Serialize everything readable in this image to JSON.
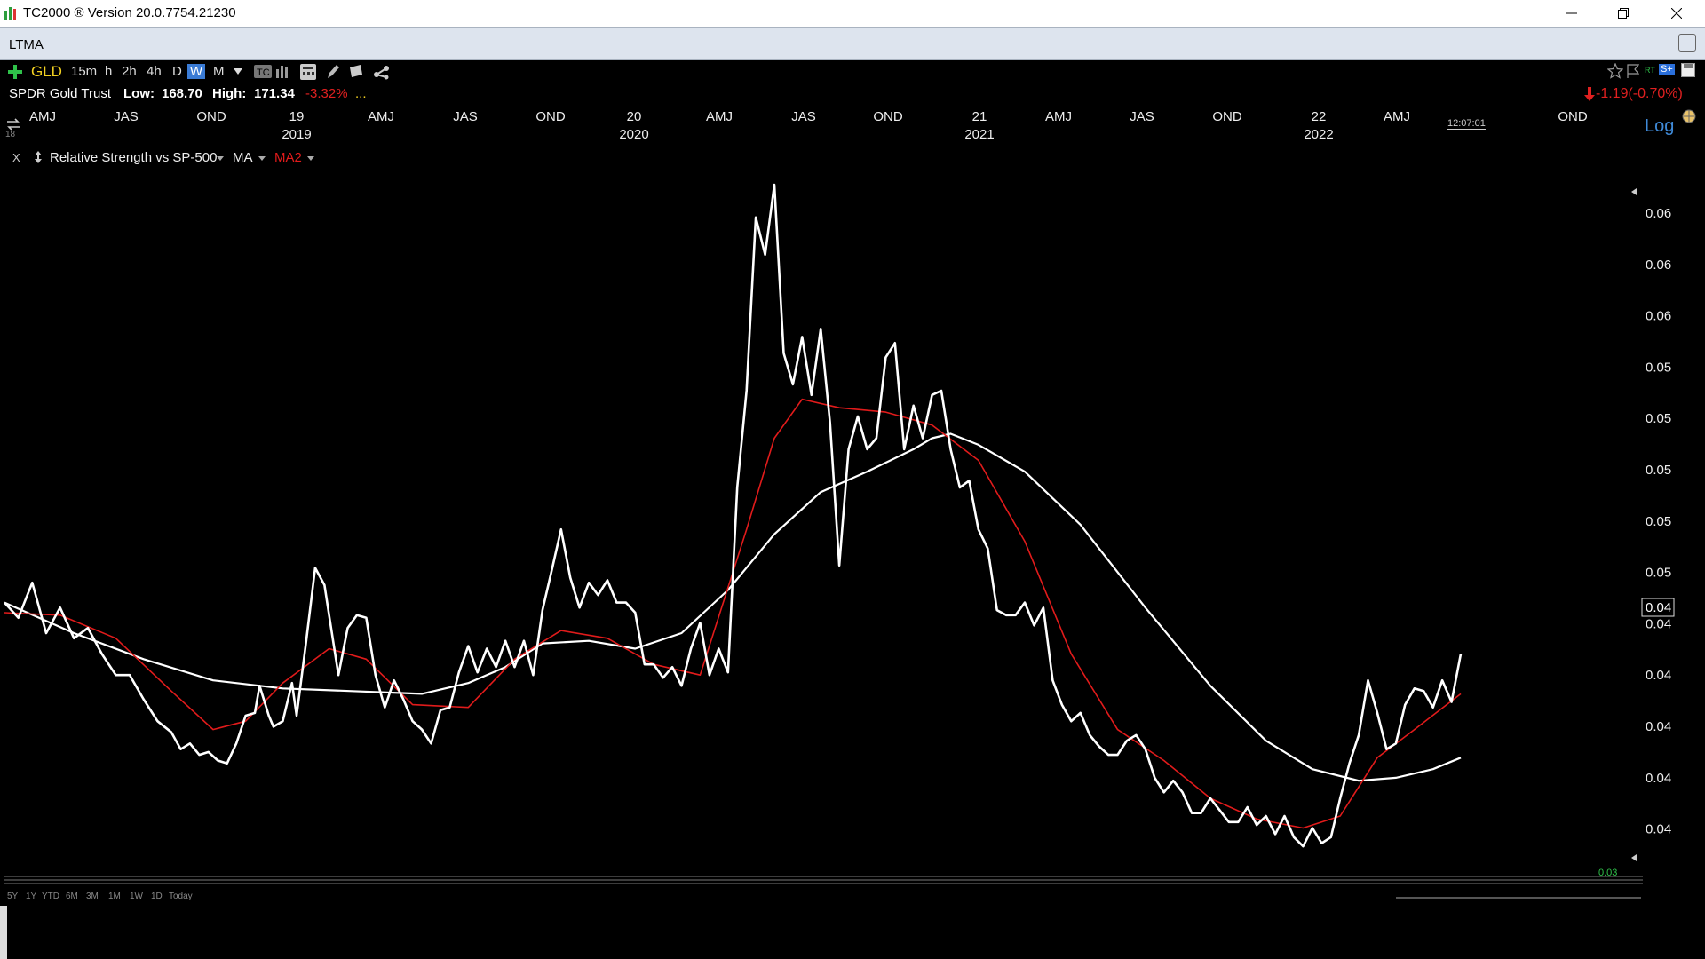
{
  "window": {
    "title": "TC2000 ® Version 20.0.7754.21230"
  },
  "tab": {
    "name": "LTMA"
  },
  "toolbar": {
    "symbol": "GLD",
    "timeframes": [
      "15m",
      "h",
      "2h",
      "4h",
      "D",
      "W",
      "M"
    ],
    "active_timeframe": "W",
    "rt_label": "RT",
    "s_label": "S+"
  },
  "info": {
    "name": "SPDR Gold Trust",
    "low_label": "Low:",
    "low_value": "168.70",
    "high_label": "High:",
    "high_value": "171.34",
    "pct_change": "-3.32%",
    "more": "...",
    "change": "-1.19(-0.70%)"
  },
  "time_axis": {
    "labels": [
      {
        "text": "AMJ",
        "row": 1
      },
      {
        "text": "JAS",
        "row": 1
      },
      {
        "text": "OND",
        "row": 1
      },
      {
        "text": "19",
        "row": 1
      },
      {
        "text": "2019",
        "row": 2
      },
      {
        "text": "AMJ",
        "row": 1
      },
      {
        "text": "JAS",
        "row": 1
      },
      {
        "text": "OND",
        "row": 1
      },
      {
        "text": "20",
        "row": 1
      },
      {
        "text": "2020",
        "row": 2
      },
      {
        "text": "AMJ",
        "row": 1
      },
      {
        "text": "JAS",
        "row": 1
      },
      {
        "text": "OND",
        "row": 1
      },
      {
        "text": "21",
        "row": 1
      },
      {
        "text": "2021",
        "row": 2
      },
      {
        "text": "AMJ",
        "row": 1
      },
      {
        "text": "JAS",
        "row": 1
      },
      {
        "text": "OND",
        "row": 1
      },
      {
        "text": "22",
        "row": 1
      },
      {
        "text": "2022",
        "row": 2
      },
      {
        "text": "AMJ",
        "row": 1
      },
      {
        "text": "OND",
        "row": 1
      }
    ],
    "clock": "12:07:01",
    "log_label": "Log",
    "corner": "18"
  },
  "indicator": {
    "close": "X",
    "name": "Relative Strength vs SP-500",
    "ma": "MA",
    "ma2": "MA2"
  },
  "price_axis": {
    "ticks": [
      "0.06",
      "0.06",
      "0.06",
      "0.05",
      "0.05",
      "0.05",
      "0.05",
      "0.05",
      "0.04",
      "0.04",
      "0.04",
      "0.04",
      "0.04"
    ],
    "current": "0.04",
    "faint": "0.03"
  },
  "range_buttons": [
    "5Y",
    "1Y",
    "YTD",
    "6M",
    "3M",
    "1M",
    "1W",
    "1D",
    "Today"
  ],
  "colors": {
    "line": "#ffffff",
    "ma_fast": "#e11b1b",
    "ma_slow": "#ffffff",
    "accent": "#3a7bd5",
    "neg": "#e02020",
    "symbol": "#f2d021"
  },
  "chart_data": {
    "type": "line",
    "y_scale": "log",
    "series": [
      {
        "points": [
          [
            0,
            0.049
          ],
          [
            3,
            0.0484
          ],
          [
            6,
            0.0498
          ],
          [
            9,
            0.0478
          ],
          [
            12,
            0.0488
          ],
          [
            15,
            0.0476
          ],
          [
            18,
            0.048
          ],
          [
            21,
            0.047
          ],
          [
            24,
            0.0462
          ],
          [
            27,
            0.0462
          ],
          [
            30,
            0.0453
          ],
          [
            33,
            0.0445
          ],
          [
            36,
            0.0441
          ],
          [
            38,
            0.0435
          ],
          [
            40,
            0.0437
          ],
          [
            42,
            0.0433
          ],
          [
            44,
            0.0434
          ],
          [
            46,
            0.0431
          ],
          [
            48,
            0.043
          ],
          [
            50,
            0.0437
          ],
          [
            52,
            0.0447
          ],
          [
            54,
            0.0448
          ],
          [
            55,
            0.0458
          ],
          [
            57,
            0.0447
          ],
          [
            58,
            0.0443
          ],
          [
            60,
            0.0445
          ],
          [
            62,
            0.0459
          ],
          [
            63,
            0.0447
          ],
          [
            65,
            0.0474
          ],
          [
            67,
            0.0504
          ],
          [
            69,
            0.0497
          ],
          [
            70,
            0.0485
          ],
          [
            72,
            0.0462
          ],
          [
            74,
            0.048
          ],
          [
            76,
            0.0485
          ],
          [
            78,
            0.0484
          ],
          [
            80,
            0.0462
          ],
          [
            82,
            0.045
          ],
          [
            84,
            0.046
          ],
          [
            86,
            0.0453
          ],
          [
            88,
            0.0445
          ],
          [
            90,
            0.0442
          ],
          [
            92,
            0.0437
          ],
          [
            94,
            0.0449
          ],
          [
            96,
            0.045
          ],
          [
            98,
            0.0463
          ],
          [
            100,
            0.0473
          ],
          [
            102,
            0.0463
          ],
          [
            104,
            0.0472
          ],
          [
            106,
            0.0465
          ],
          [
            108,
            0.0475
          ],
          [
            110,
            0.0465
          ],
          [
            112,
            0.0475
          ],
          [
            114,
            0.0462
          ],
          [
            116,
            0.0487
          ],
          [
            118,
            0.0503
          ],
          [
            120,
            0.052
          ],
          [
            122,
            0.05
          ],
          [
            124,
            0.0488
          ],
          [
            126,
            0.0498
          ],
          [
            128,
            0.0493
          ],
          [
            130,
            0.0499
          ],
          [
            132,
            0.049
          ],
          [
            134,
            0.049
          ],
          [
            136,
            0.0486
          ],
          [
            138,
            0.0466
          ],
          [
            140,
            0.0466
          ],
          [
            142,
            0.0461
          ],
          [
            144,
            0.0465
          ],
          [
            146,
            0.0458
          ],
          [
            148,
            0.0472
          ],
          [
            150,
            0.0482
          ],
          [
            152,
            0.0462
          ],
          [
            154,
            0.0472
          ],
          [
            156,
            0.0463
          ],
          [
            158,
            0.0538
          ],
          [
            160,
            0.0582
          ],
          [
            162,
            0.067
          ],
          [
            164,
            0.065
          ],
          [
            166,
            0.0688
          ],
          [
            168,
            0.06
          ],
          [
            170,
            0.0585
          ],
          [
            172,
            0.0608
          ],
          [
            174,
            0.058
          ],
          [
            176,
            0.0612
          ],
          [
            178,
            0.0567
          ],
          [
            180,
            0.0505
          ],
          [
            182,
            0.0555
          ],
          [
            184,
            0.057
          ],
          [
            186,
            0.0555
          ],
          [
            188,
            0.056
          ],
          [
            190,
            0.0598
          ],
          [
            192,
            0.0605
          ],
          [
            194,
            0.0555
          ],
          [
            196,
            0.0575
          ],
          [
            198,
            0.056
          ],
          [
            200,
            0.058
          ],
          [
            202,
            0.0582
          ],
          [
            204,
            0.0555
          ],
          [
            206,
            0.0538
          ],
          [
            208,
            0.0541
          ],
          [
            210,
            0.052
          ],
          [
            212,
            0.0512
          ],
          [
            214,
            0.0487
          ],
          [
            216,
            0.0485
          ],
          [
            218,
            0.0485
          ],
          [
            220,
            0.049
          ],
          [
            222,
            0.0481
          ],
          [
            224,
            0.0488
          ],
          [
            226,
            0.046
          ],
          [
            228,
            0.0451
          ],
          [
            230,
            0.0445
          ],
          [
            232,
            0.0448
          ],
          [
            234,
            0.044
          ],
          [
            236,
            0.0436
          ],
          [
            238,
            0.0433
          ],
          [
            240,
            0.0433
          ],
          [
            242,
            0.0438
          ],
          [
            244,
            0.044
          ],
          [
            246,
            0.0435
          ],
          [
            248,
            0.0425
          ],
          [
            250,
            0.042
          ],
          [
            252,
            0.0424
          ],
          [
            254,
            0.042
          ],
          [
            256,
            0.0413
          ],
          [
            258,
            0.0413
          ],
          [
            260,
            0.0418
          ],
          [
            262,
            0.0414
          ],
          [
            264,
            0.041
          ],
          [
            266,
            0.041
          ],
          [
            268,
            0.0415
          ],
          [
            270,
            0.0409
          ],
          [
            272,
            0.0412
          ],
          [
            274,
            0.0406
          ],
          [
            276,
            0.0412
          ],
          [
            278,
            0.0405
          ],
          [
            280,
            0.0402
          ],
          [
            282,
            0.0408
          ],
          [
            284,
            0.0403
          ],
          [
            286,
            0.0405
          ],
          [
            288,
            0.0418
          ],
          [
            290,
            0.043
          ],
          [
            292,
            0.044
          ],
          [
            294,
            0.046
          ],
          [
            296,
            0.0448
          ],
          [
            298,
            0.0435
          ],
          [
            300,
            0.0437
          ],
          [
            302,
            0.0451
          ],
          [
            304,
            0.0457
          ],
          [
            306,
            0.0456
          ],
          [
            308,
            0.045
          ],
          [
            310,
            0.046
          ],
          [
            312,
            0.0452
          ],
          [
            314,
            0.047
          ]
        ]
      },
      {
        "points": [
          [
            0,
            0.0486
          ],
          [
            12,
            0.0485
          ],
          [
            24,
            0.0476
          ],
          [
            36,
            0.0456
          ],
          [
            45,
            0.0442
          ],
          [
            52,
            0.0445
          ],
          [
            60,
            0.0459
          ],
          [
            70,
            0.0472
          ],
          [
            78,
            0.0468
          ],
          [
            88,
            0.0451
          ],
          [
            100,
            0.045
          ],
          [
            110,
            0.0468
          ],
          [
            120,
            0.0479
          ],
          [
            130,
            0.0476
          ],
          [
            140,
            0.0466
          ],
          [
            150,
            0.0462
          ],
          [
            160,
            0.052
          ],
          [
            166,
            0.056
          ],
          [
            172,
            0.0578
          ],
          [
            180,
            0.0574
          ],
          [
            190,
            0.0572
          ],
          [
            200,
            0.0566
          ],
          [
            210,
            0.055
          ],
          [
            220,
            0.0515
          ],
          [
            230,
            0.047
          ],
          [
            240,
            0.0442
          ],
          [
            250,
            0.0431
          ],
          [
            260,
            0.0418
          ],
          [
            270,
            0.0411
          ],
          [
            280,
            0.0408
          ],
          [
            288,
            0.0412
          ],
          [
            296,
            0.0432
          ],
          [
            304,
            0.0442
          ],
          [
            314,
            0.0455
          ]
        ]
      },
      {
        "points": [
          [
            0,
            0.049
          ],
          [
            15,
            0.0478
          ],
          [
            30,
            0.0468
          ],
          [
            45,
            0.046
          ],
          [
            60,
            0.0457
          ],
          [
            75,
            0.0456
          ],
          [
            90,
            0.0455
          ],
          [
            100,
            0.0459
          ],
          [
            108,
            0.0465
          ],
          [
            116,
            0.0474
          ],
          [
            126,
            0.0475
          ],
          [
            136,
            0.0472
          ],
          [
            146,
            0.0478
          ],
          [
            156,
            0.0495
          ],
          [
            166,
            0.0518
          ],
          [
            176,
            0.0536
          ],
          [
            186,
            0.0545
          ],
          [
            196,
            0.0555
          ],
          [
            200,
            0.056
          ],
          [
            204,
            0.0562
          ],
          [
            210,
            0.0557
          ],
          [
            220,
            0.0545
          ],
          [
            232,
            0.0522
          ],
          [
            246,
            0.0488
          ],
          [
            260,
            0.0458
          ],
          [
            272,
            0.0438
          ],
          [
            282,
            0.0428
          ],
          [
            292,
            0.0424
          ],
          [
            300,
            0.0425
          ],
          [
            308,
            0.0428
          ],
          [
            314,
            0.0432
          ]
        ]
      }
    ]
  }
}
